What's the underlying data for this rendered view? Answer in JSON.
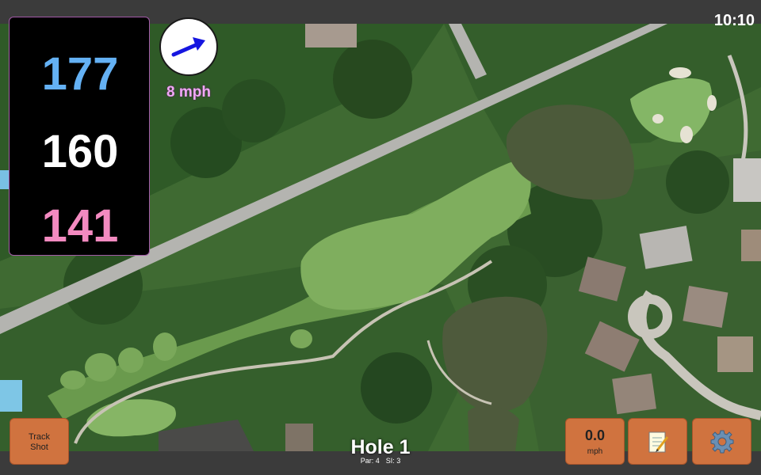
{
  "status_bar": {
    "time": "10:10"
  },
  "distances": {
    "back": "177",
    "middle": "160",
    "front": "141"
  },
  "wind": {
    "speed_label": "8 mph",
    "direction": "arrow-east-northeast-icon"
  },
  "buttons": {
    "track_shot": "Track\nShot",
    "speed_value": "0.0",
    "speed_unit": "mph",
    "notes_icon": "notepad-icon",
    "settings_icon": "gear-icon"
  },
  "hole": {
    "title": "Hole 1",
    "par": "Par: 4",
    "si": "SI: 3"
  },
  "colors": {
    "back_distance": "#64b1f4",
    "middle_distance": "#ffffff",
    "front_distance": "#f38ac0",
    "button": "#d0733f",
    "wind_text": "#f0a8f5",
    "arrow": "#1616e0"
  }
}
